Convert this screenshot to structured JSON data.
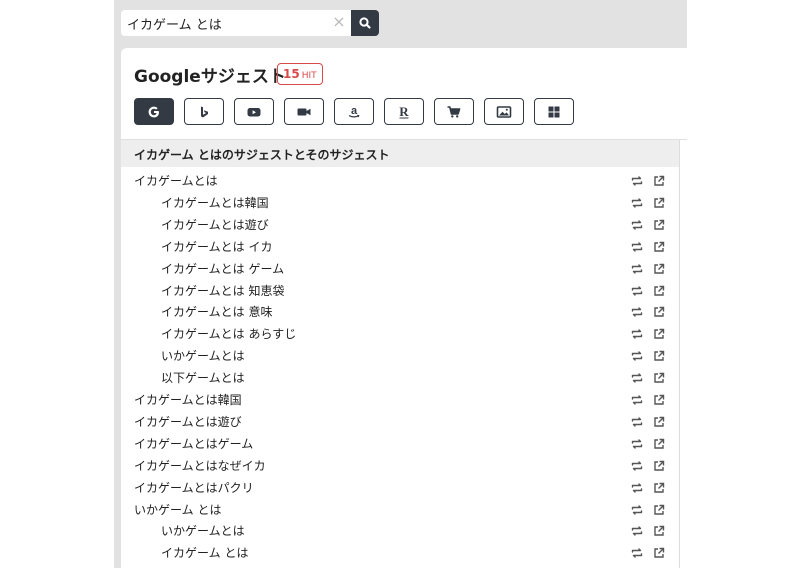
{
  "search": {
    "query": "イカゲーム とは",
    "clear_glyph": "×"
  },
  "panel": {
    "title": "Googleサジェスト",
    "hit_count": "15",
    "hit_unit": "HIT"
  },
  "tabs": [
    {
      "icon": "google-icon",
      "active": true
    },
    {
      "icon": "bing-icon",
      "active": false
    },
    {
      "icon": "youtube-icon",
      "active": false
    },
    {
      "icon": "video-icon",
      "active": false
    },
    {
      "icon": "amazon-icon",
      "active": false
    },
    {
      "icon": "rakuten-icon",
      "active": false
    },
    {
      "icon": "cart-icon",
      "active": false
    },
    {
      "icon": "image-icon",
      "active": false
    },
    {
      "icon": "apps-icon",
      "active": false
    }
  ],
  "list": {
    "header": "イカゲーム とはのサジェストとそのサジェスト",
    "items": [
      {
        "label": "イカゲームとは",
        "indent": false
      },
      {
        "label": "イカゲームとは韓国",
        "indent": true
      },
      {
        "label": "イカゲームとは遊び",
        "indent": true
      },
      {
        "label": "イカゲームとは イカ",
        "indent": true
      },
      {
        "label": "イカゲームとは ゲーム",
        "indent": true
      },
      {
        "label": "イカゲームとは 知恵袋",
        "indent": true
      },
      {
        "label": "イカゲームとは 意味",
        "indent": true
      },
      {
        "label": "イカゲームとは あらすじ",
        "indent": true
      },
      {
        "label": "いかゲームとは",
        "indent": true
      },
      {
        "label": "以下ゲームとは",
        "indent": true
      },
      {
        "label": "イカゲームとは韓国",
        "indent": false
      },
      {
        "label": "イカゲームとは遊び",
        "indent": false
      },
      {
        "label": "イカゲームとはゲーム",
        "indent": false
      },
      {
        "label": "イカゲームとはなぜイカ",
        "indent": false
      },
      {
        "label": "イカゲームとはパクリ",
        "indent": false
      },
      {
        "label": "いかゲーム とは",
        "indent": false
      },
      {
        "label": "いかゲームとは",
        "indent": true
      },
      {
        "label": "イカゲーム とは",
        "indent": true
      }
    ]
  },
  "colors": {
    "accent": "#333a44",
    "badge": "#d84a4a",
    "panel_bg": "#e2e2e2"
  }
}
